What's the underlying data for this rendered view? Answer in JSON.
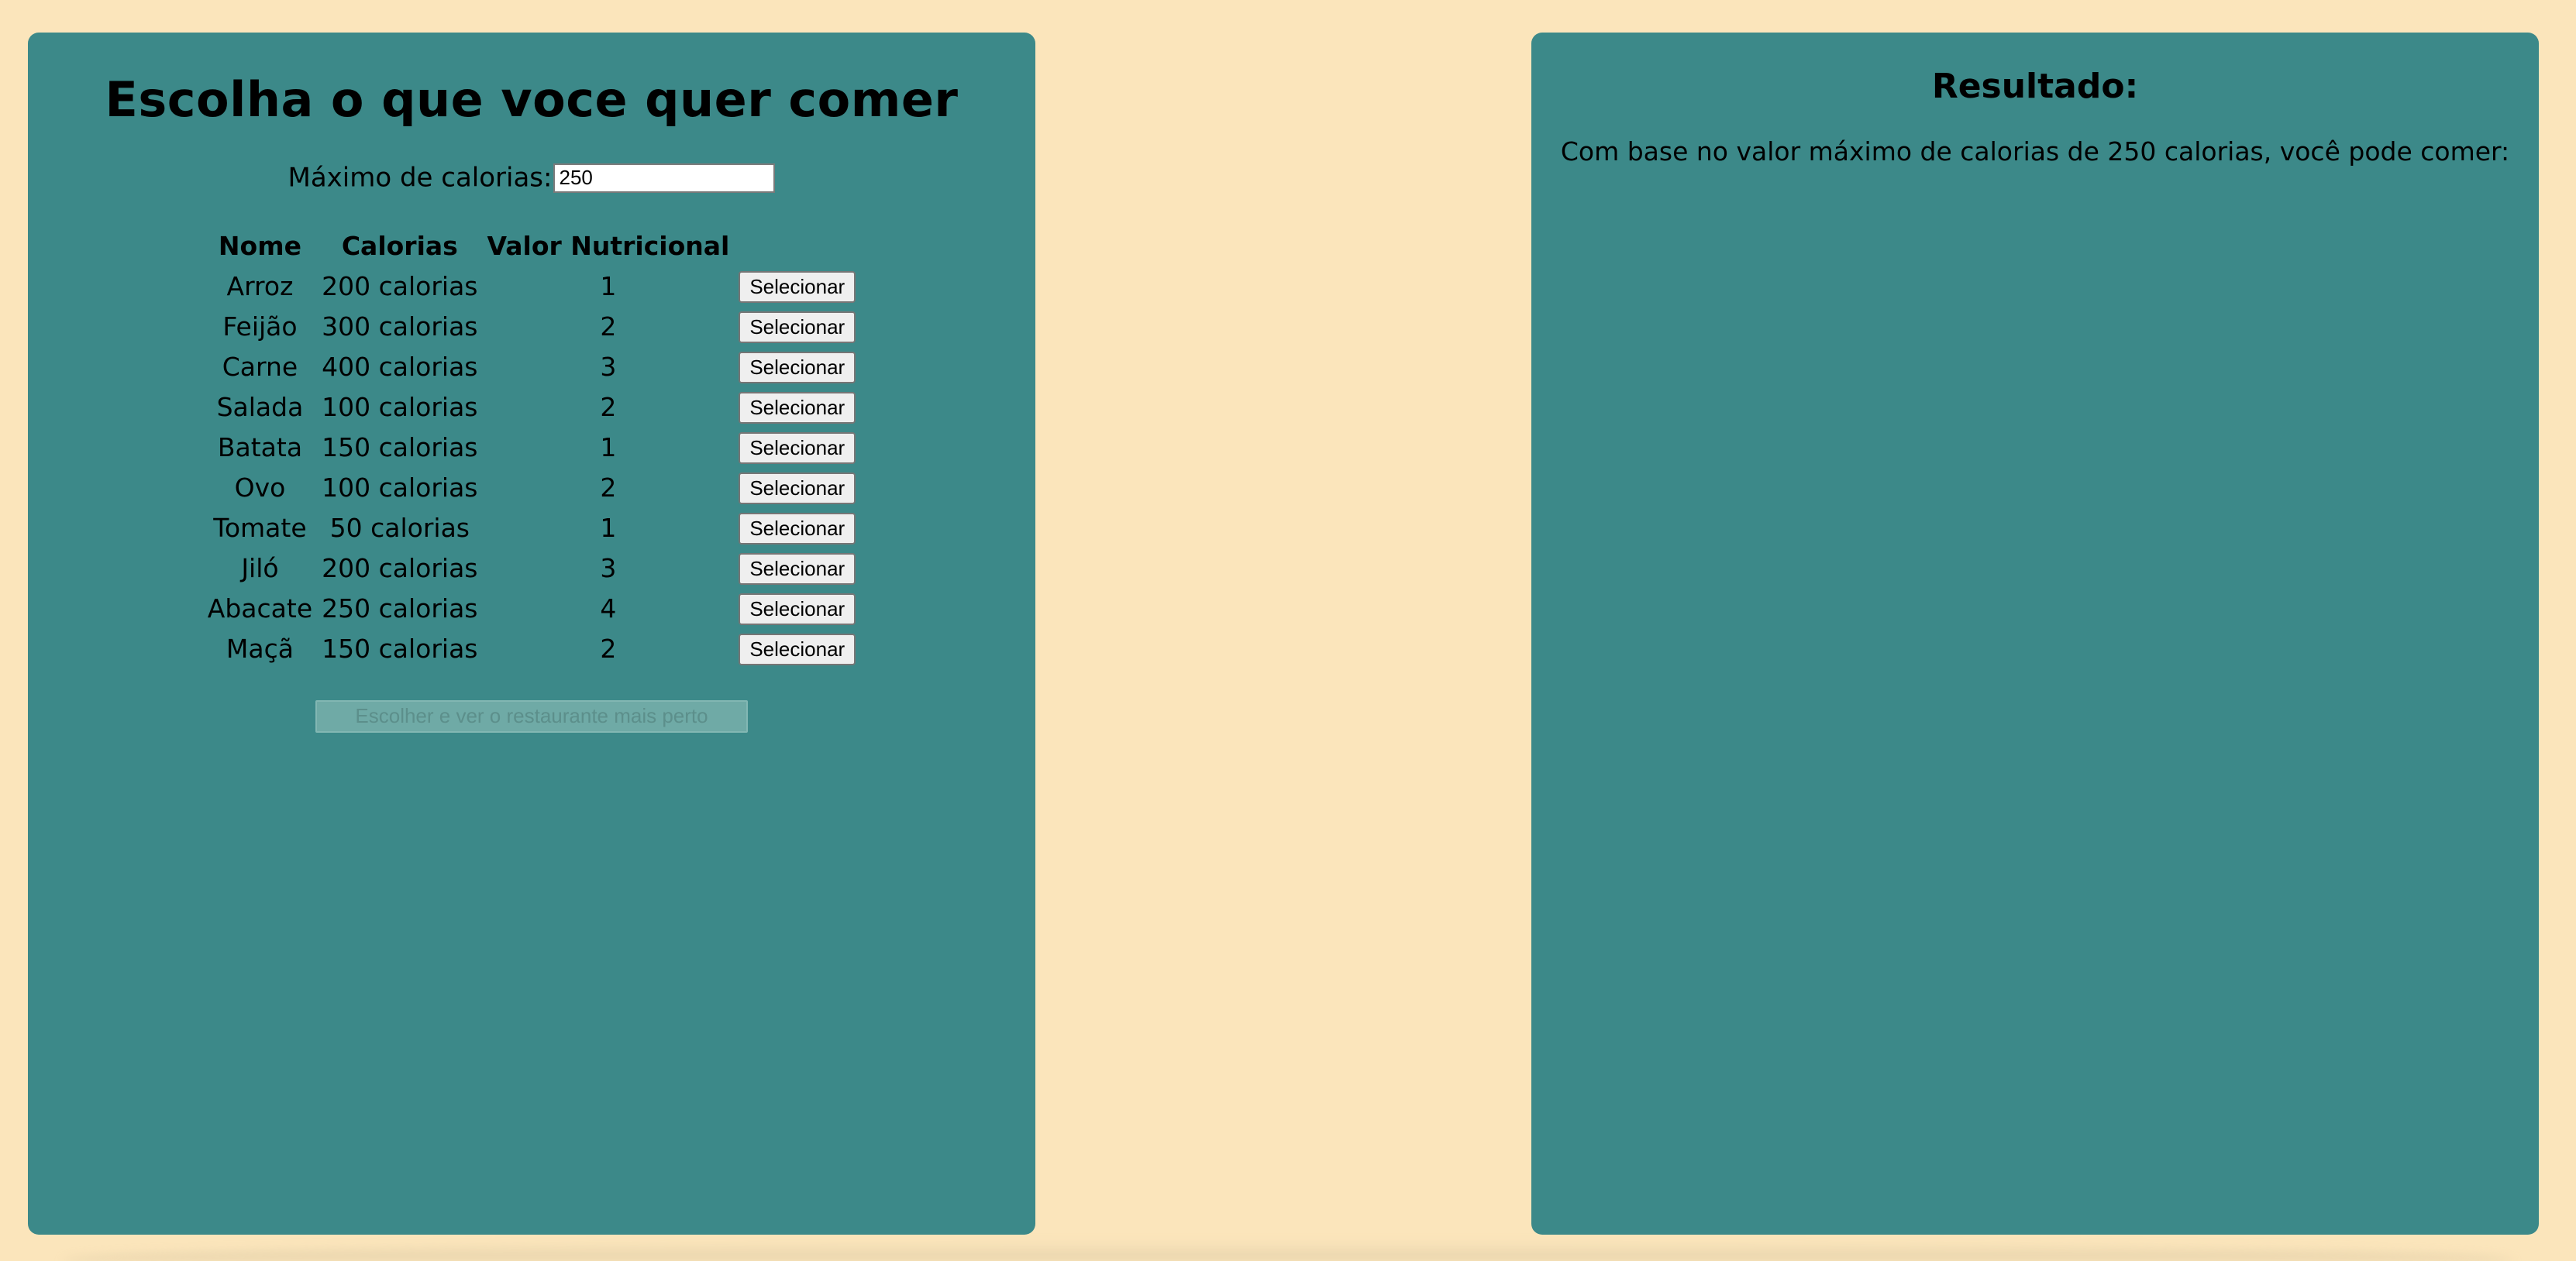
{
  "left_panel": {
    "title": "Escolha o que voce quer comer",
    "max_calories_label": "Máximo de calorias:",
    "max_calories_value": "250",
    "table": {
      "headers": [
        "Nome",
        "Calorias",
        "Valor Nutricional",
        ""
      ],
      "rows": [
        {
          "name": "Arroz",
          "calories": "200 calorias",
          "nutrition": "1",
          "button": "Selecionar"
        },
        {
          "name": "Feijão",
          "calories": "300 calorias",
          "nutrition": "2",
          "button": "Selecionar"
        },
        {
          "name": "Carne",
          "calories": "400 calorias",
          "nutrition": "3",
          "button": "Selecionar"
        },
        {
          "name": "Salada",
          "calories": "100 calorias",
          "nutrition": "2",
          "button": "Selecionar"
        },
        {
          "name": "Batata",
          "calories": "150 calorias",
          "nutrition": "1",
          "button": "Selecionar"
        },
        {
          "name": "Ovo",
          "calories": "100 calorias",
          "nutrition": "2",
          "button": "Selecionar"
        },
        {
          "name": "Tomate",
          "calories": "50 calorias",
          "nutrition": "1",
          "button": "Selecionar"
        },
        {
          "name": "Jiló",
          "calories": "200 calorias",
          "nutrition": "3",
          "button": "Selecionar"
        },
        {
          "name": "Abacate",
          "calories": "250 calorias",
          "nutrition": "4",
          "button": "Selecionar"
        },
        {
          "name": "Maçã",
          "calories": "150 calorias",
          "nutrition": "2",
          "button": "Selecionar"
        }
      ]
    },
    "choose_button": "Escolher e ver o restaurante mais perto"
  },
  "right_panel": {
    "title": "Resultado:",
    "text": "Com base no valor máximo de calorias de 250 calorias, você pode comer:"
  },
  "colors": {
    "background": "#fbe5bb",
    "panel": "#3c8989",
    "disabled_button": "#6faaa6"
  }
}
